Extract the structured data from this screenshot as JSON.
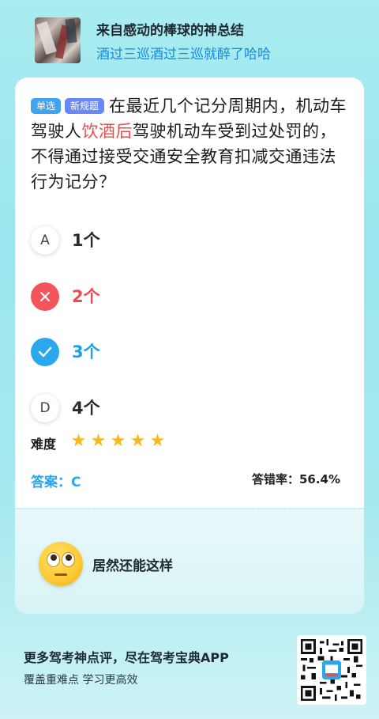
{
  "header": {
    "author": "来自感动的棒球的神总结",
    "subtitle": "酒过三巡酒过三巡就醉了哈哈"
  },
  "question": {
    "tags": [
      "单选",
      "新规题"
    ],
    "text_before": "在最近几个记分周期内，机动车驾驶人",
    "text_highlight": "饮酒后",
    "text_after": "驾驶机动车受到过处罚的，不得通过接受交通安全教育扣减交通违法行为记分？"
  },
  "options": [
    {
      "marker": "A",
      "text": "1个",
      "state": "normal"
    },
    {
      "marker": "✕",
      "text": "2个",
      "state": "wrong"
    },
    {
      "marker": "✓",
      "text": "3个",
      "state": "correct"
    },
    {
      "marker": "D",
      "text": "4个",
      "state": "normal"
    }
  ],
  "difficulty": {
    "label": "难度",
    "stars": 5,
    "star_glyph": "★"
  },
  "answer": {
    "label": "答案：C"
  },
  "error_rate": {
    "label": "答错率：56.4%"
  },
  "comment": {
    "emoji": "eye-roll-emoji",
    "text": "居然还能这样"
  },
  "footer": {
    "line1": "更多驾考神点评，尽在驾考宝典APP",
    "line2": "覆盖重难点 学习更高效"
  },
  "colors": {
    "accent_blue": "#2aa8ee",
    "wrong_red": "#f4555b",
    "highlight_red": "#f24a4a",
    "star_yellow": "#f8b820"
  }
}
